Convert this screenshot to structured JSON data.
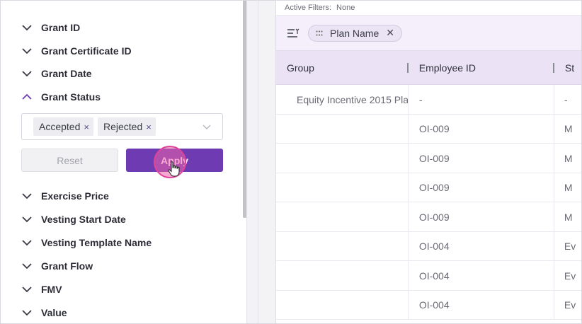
{
  "filters": {
    "rows": [
      {
        "label": "Grant ID",
        "expanded": false
      },
      {
        "label": "Grant Certificate ID",
        "expanded": false
      },
      {
        "label": "Grant Date",
        "expanded": false
      },
      {
        "label": "Grant Status",
        "expanded": true
      },
      {
        "label": "Exercise Price",
        "expanded": false
      },
      {
        "label": "Vesting Start Date",
        "expanded": false
      },
      {
        "label": "Vesting Template Name",
        "expanded": false
      },
      {
        "label": "Grant Flow",
        "expanded": false
      },
      {
        "label": "FMV",
        "expanded": false
      },
      {
        "label": "Value",
        "expanded": false
      }
    ],
    "grant_status": {
      "selected": [
        "Accepted",
        "Rejected"
      ],
      "remove_glyph": "×"
    },
    "reset_label": "Reset",
    "apply_label": "Apply"
  },
  "grid": {
    "active_filters_label": "Active Filters:",
    "active_filters_value": "None",
    "group_chip_label": "Plan Name",
    "group_chip_remove": "✕",
    "columns": [
      "Group",
      "Employee ID",
      "St"
    ],
    "group_row": {
      "group": "Equity Incentive 2015 Pla",
      "employee_id": "-",
      "third": "-"
    },
    "rows": [
      {
        "group": "",
        "employee_id": "OI-009",
        "third": "M"
      },
      {
        "group": "",
        "employee_id": "OI-009",
        "third": "M"
      },
      {
        "group": "",
        "employee_id": "OI-009",
        "third": "M"
      },
      {
        "group": "",
        "employee_id": "OI-009",
        "third": "M"
      },
      {
        "group": "",
        "employee_id": "OI-004",
        "third": "Ev"
      },
      {
        "group": "",
        "employee_id": "OI-004",
        "third": "Ev"
      },
      {
        "group": "",
        "employee_id": "OI-004",
        "third": "Ev"
      }
    ]
  },
  "colors": {
    "accent": "#6e3bb3",
    "header_bg": "#ebe3f5",
    "group_bar_bg": "#f4effa",
    "click_highlight": "#e0449a"
  },
  "icons": {
    "filter_chevron": "chevron-down-icon",
    "filter_chevron_open": "chevron-up-icon",
    "group_by": "group-by-icon",
    "drag_handle": "drag-handle-icon",
    "cursor": "hand-pointer-icon"
  }
}
